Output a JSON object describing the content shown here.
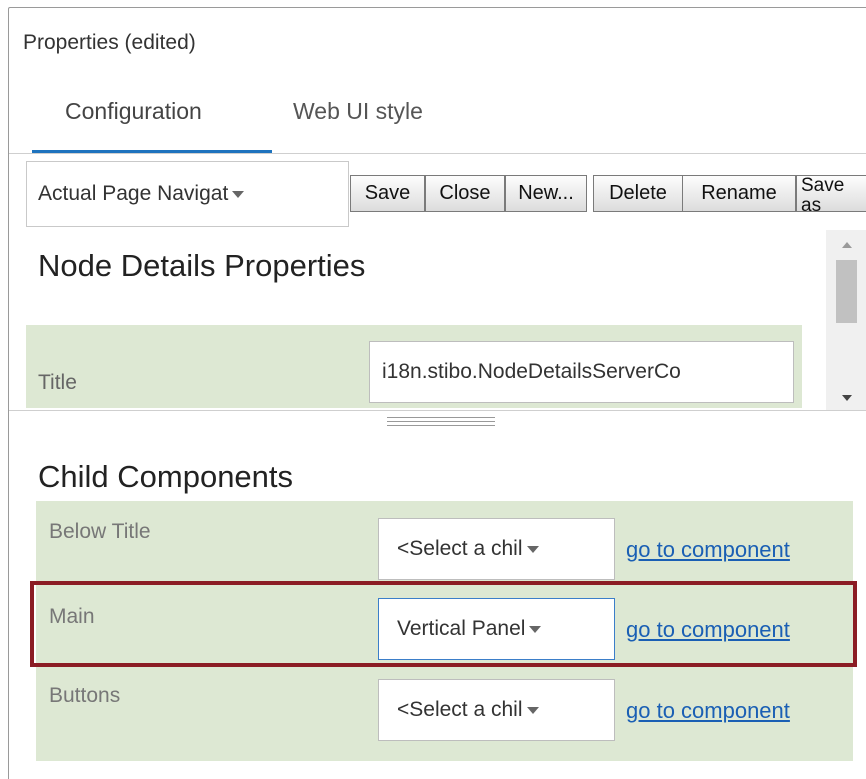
{
  "panel": {
    "title": "Properties (edited)"
  },
  "tabs": [
    {
      "label": "Configuration",
      "active": true
    },
    {
      "label": "Web UI style",
      "active": false
    }
  ],
  "toolbar": {
    "page_select_value": "Actual Page Navigat",
    "buttons": {
      "save": "Save",
      "close": "Close",
      "new": "New...",
      "delete": "Delete",
      "rename": "Rename",
      "save_as": "Save as"
    }
  },
  "node_details": {
    "heading": "Node Details Properties",
    "title_label": "Title",
    "title_value": "i18n.stibo.NodeDetailsServerCo"
  },
  "child_components": {
    "heading": "Child Components",
    "rows": [
      {
        "label": "Below Title",
        "select_value": "<Select a chil",
        "link": "go to component"
      },
      {
        "label": "Main",
        "select_value": "Vertical Panel",
        "link": "go to component"
      },
      {
        "label": "Buttons",
        "select_value": "<Select a chil",
        "link": "go to component"
      }
    ]
  },
  "colors": {
    "accent": "#1e73be",
    "property_background": "#dde8d3",
    "highlight_border": "#8b1c24",
    "link": "#1a5fb4"
  }
}
